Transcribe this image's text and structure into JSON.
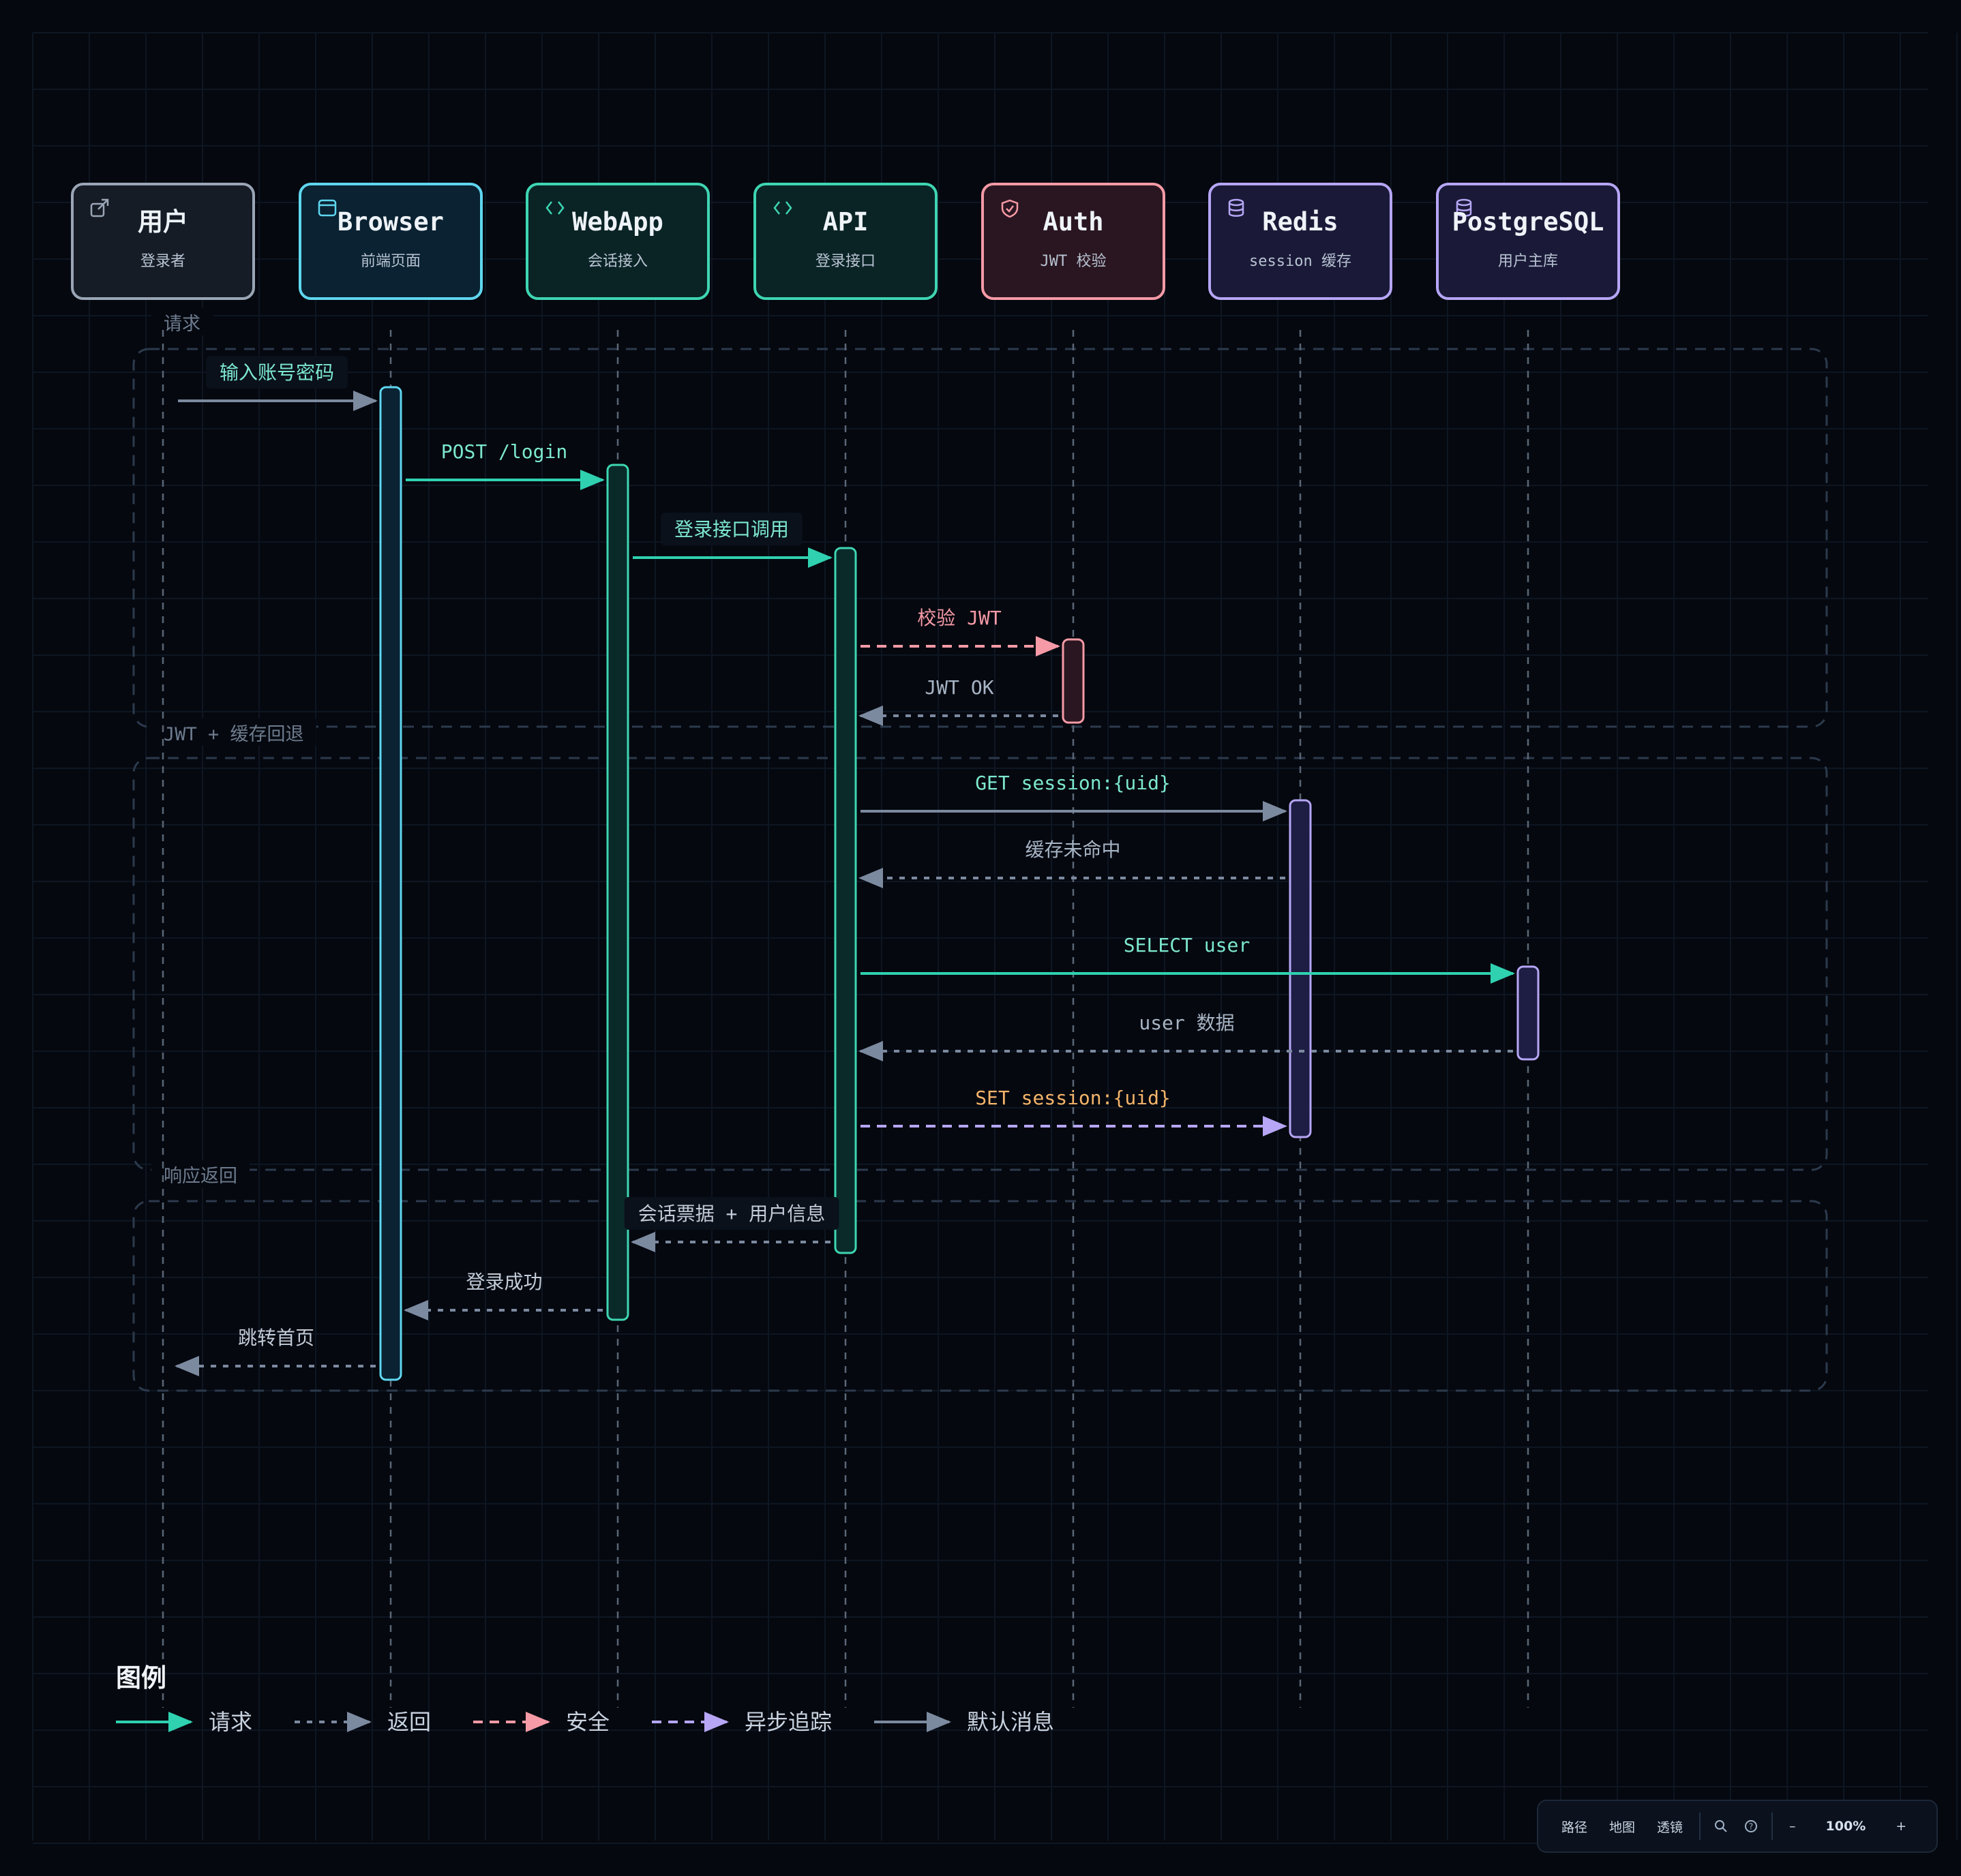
{
  "participants": [
    {
      "name": "用户",
      "sub": "登录者",
      "color": "#9aa6b6",
      "fill": "#161c26",
      "icon": "external-link-icon"
    },
    {
      "name": "Browser",
      "sub": "前端页面",
      "color": "#5fd6ef",
      "fill": "#0a2232",
      "icon": "browser-window-icon"
    },
    {
      "name": "WebApp",
      "sub": "会话接入",
      "color": "#3ed6b2",
      "fill": "#0a2426",
      "icon": "code-icon"
    },
    {
      "name": "API",
      "sub": "登录接口",
      "color": "#3ed6b2",
      "fill": "#0a2426",
      "icon": "code-icon"
    },
    {
      "name": "Auth",
      "sub": "JWT 校验",
      "color": "#f59aa6",
      "fill": "#2a1620",
      "icon": "shield-icon"
    },
    {
      "name": "Redis",
      "sub": "session 缓存",
      "color": "#b6a6f5",
      "fill": "#1a1a38",
      "icon": "database-icon"
    },
    {
      "name": "PostgreSQL",
      "sub": "用户主库",
      "color": "#b6a6f5",
      "fill": "#1a1a38",
      "icon": "database-icon"
    }
  ],
  "groups": [
    {
      "label": "请求"
    },
    {
      "label": "JWT + 缓存回退"
    },
    {
      "label": "响应返回"
    }
  ],
  "messages": [
    {
      "from": 0,
      "to": 1,
      "label": "输入账号密码",
      "kind": "default",
      "labelColor": "#7de8cf",
      "labelBox": true
    },
    {
      "from": 1,
      "to": 2,
      "label": "POST /login",
      "kind": "request",
      "labelColor": "#7de8cf",
      "labelBox": false
    },
    {
      "from": 2,
      "to": 3,
      "label": "登录接口调用",
      "kind": "request",
      "labelColor": "#7de8cf",
      "labelBox": true
    },
    {
      "from": 3,
      "to": 4,
      "label": "校验 JWT",
      "kind": "security",
      "labelColor": "#f59aa6",
      "labelBox": false
    },
    {
      "from": 4,
      "to": 3,
      "label": "JWT OK",
      "kind": "return",
      "labelColor": "#a7b4c4",
      "labelBox": false
    },
    {
      "from": 3,
      "to": 5,
      "label": "GET session:{uid}",
      "kind": "default",
      "labelColor": "#7de8cf",
      "labelBox": false
    },
    {
      "from": 5,
      "to": 3,
      "label": "缓存未命中",
      "kind": "return",
      "labelColor": "#a7b4c4",
      "labelBox": false
    },
    {
      "from": 3,
      "to": 6,
      "label": "SELECT user",
      "kind": "request",
      "labelColor": "#7de8cf",
      "labelBox": false
    },
    {
      "from": 6,
      "to": 3,
      "label": "user 数据",
      "kind": "return",
      "labelColor": "#a7b4c4",
      "labelBox": false
    },
    {
      "from": 3,
      "to": 5,
      "label": "SET session:{uid}",
      "kind": "async",
      "labelColor": "#f5b46a",
      "labelBox": false
    },
    {
      "from": 3,
      "to": 2,
      "label": "会话票据 + 用户信息",
      "kind": "return",
      "labelColor": "#c3ccd8",
      "labelBox": true
    },
    {
      "from": 2,
      "to": 1,
      "label": "登录成功",
      "kind": "return",
      "labelColor": "#c3ccd8",
      "labelBox": false
    },
    {
      "from": 1,
      "to": 0,
      "label": "跳转首页",
      "kind": "return",
      "labelColor": "#c3ccd8",
      "labelBox": false
    }
  ],
  "activations": [
    {
      "lane": 1,
      "color": "#5fd6ef",
      "fill": "#0a2232"
    },
    {
      "lane": 2,
      "color": "#3ed6b2",
      "fill": "#0a2a2a"
    },
    {
      "lane": 3,
      "color": "#3ed6b2",
      "fill": "#0a2a2a"
    },
    {
      "lane": 4,
      "color": "#f59aa6",
      "fill": "#2a1620"
    },
    {
      "lane": 5,
      "color": "#b6a6f5",
      "fill": "#1e1d44"
    },
    {
      "lane": 6,
      "color": "#b6a6f5",
      "fill": "#1e1d44"
    }
  ],
  "message_styles": {
    "request": {
      "color": "#2fd1b0",
      "dash": "none"
    },
    "return": {
      "color": "#7c8aa0",
      "dash": "dotted"
    },
    "security": {
      "color": "#f59aa6",
      "dash": "dashed"
    },
    "async": {
      "color": "#b6a6f5",
      "dash": "dashed"
    },
    "default": {
      "color": "#7c8aa0",
      "dash": "none"
    }
  },
  "legend": {
    "title": "图例",
    "items": [
      {
        "kind": "request",
        "label": "请求"
      },
      {
        "kind": "return",
        "label": "返回"
      },
      {
        "kind": "security",
        "label": "安全"
      },
      {
        "kind": "async",
        "label": "异步追踪"
      },
      {
        "kind": "default",
        "label": "默认消息"
      }
    ]
  },
  "toolbar": {
    "path_label": "路径",
    "map_label": "地图",
    "lens_label": "透镜",
    "search_icon": "search-icon",
    "help_icon": "help-icon",
    "zoom_out": "–",
    "zoom_level": "100%",
    "zoom_in": "+"
  },
  "colors": {
    "background": "#05080f",
    "grid": "#0e1622",
    "lifeline": "#5a6676",
    "group_border": "#2c3a4d",
    "group_label": "#6d7b8e"
  }
}
